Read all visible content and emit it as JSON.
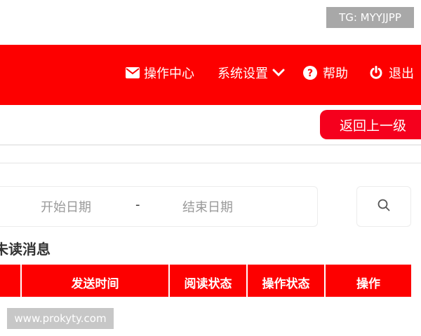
{
  "watermark_top": "TG: MYYJJPP",
  "watermark_bottom": "www.prokyty.com",
  "nav": {
    "items": [
      {
        "label": "操作中心",
        "icon": "mail-icon"
      },
      {
        "label": "系统设置",
        "icon": "chevron-down-icon"
      },
      {
        "label": "帮助",
        "icon": "help-circle-icon"
      },
      {
        "label": "退出",
        "icon": "power-icon"
      }
    ]
  },
  "toolbar": {
    "back_label": "返回上一级"
  },
  "filter": {
    "start_placeholder": "开始日期",
    "separator": "-",
    "end_placeholder": "结束日期",
    "search_icon": "search-icon"
  },
  "section": {
    "title": "未读消息"
  },
  "table": {
    "headers": [
      "发送时间",
      "阅读状态",
      "操作状态",
      "操作"
    ]
  },
  "colors": {
    "brand_red": "#fd0000",
    "button_red": "#f5001d"
  }
}
